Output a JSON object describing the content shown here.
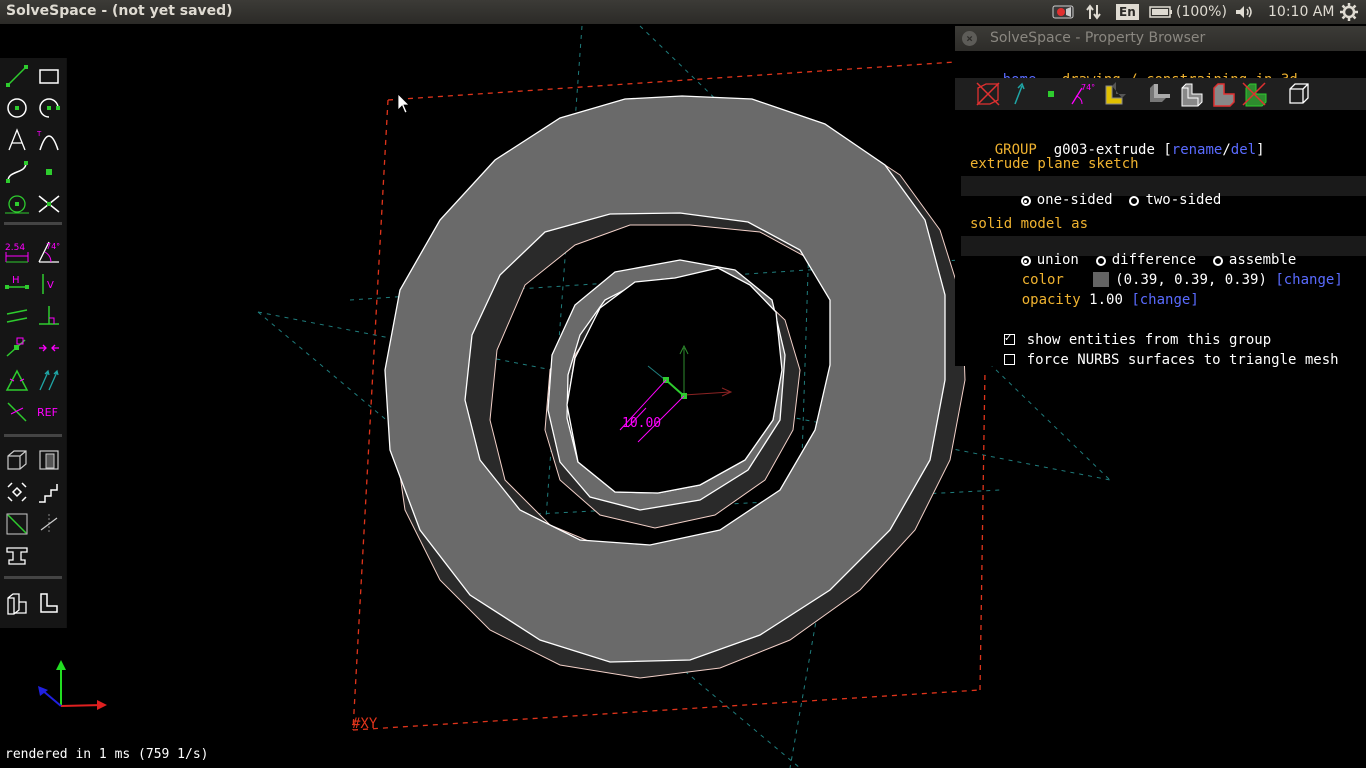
{
  "topbar": {
    "window_title": "SolveSpace - (not yet saved)",
    "keyboard": "En",
    "battery": "(100%)",
    "clock": "10:10 AM"
  },
  "viewport": {
    "dimension_label": "10.00",
    "workplane_label": "#XY",
    "status": "rendered in 1 ms (759 1/s)"
  },
  "toolbar": {
    "dimension_label": "2.54",
    "angle_label": "74°",
    "horizontal_label": "H",
    "vertical_label": "V",
    "ref_label": "REF"
  },
  "property_browser": {
    "title": "SolveSpace - Property Browser",
    "nav": {
      "home": "home",
      "path": "drawing / constraining in 3d"
    },
    "angle_icon_label": "74°",
    "group": {
      "label": "GROUP",
      "name": "g003-extrude",
      "bracket_open": "[",
      "rename": "rename",
      "slash": "/",
      "del": "del",
      "bracket_close": "]"
    },
    "extrude": {
      "heading": "extrude plane sketch",
      "one_sided": "one-sided",
      "two_sided": "two-sided"
    },
    "solid": {
      "heading": "solid model as",
      "union": "union",
      "difference": "difference",
      "assemble": "assemble"
    },
    "color": {
      "label": "color",
      "value": "(0.39, 0.39, 0.39)",
      "change": "[change]",
      "swatch": "#646464"
    },
    "opacity": {
      "label": "opacity",
      "value": "1.00",
      "change": "[change]"
    },
    "show_entities": "show entities from this group",
    "force_nurbs": "force NURBS surfaces to triangle mesh"
  },
  "colors": {
    "accent_link": "#5a6bff",
    "heading": "#f0b330",
    "tool_green": "#2ecc2e",
    "tool_magenta": "#ff00ff",
    "workplane": "#e0341b",
    "solid_face": "#6a6a6a"
  }
}
